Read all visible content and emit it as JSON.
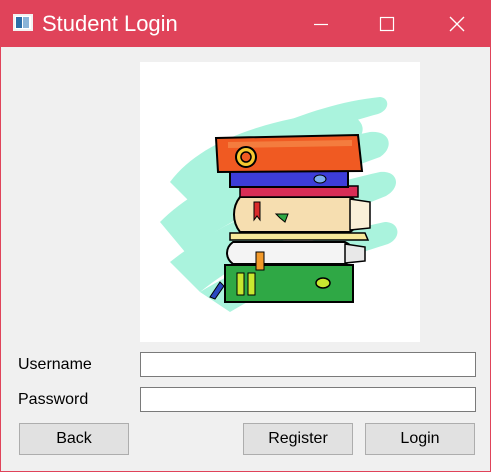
{
  "window": {
    "title": "Student Login",
    "accent_color": "#e0435a",
    "app_icon": "window-app-icon",
    "controls": [
      "minimize-icon",
      "maximize-icon",
      "close-icon"
    ]
  },
  "illustration": {
    "icon": "stack-of-books-icon"
  },
  "form": {
    "username_label": "Username",
    "username_value": "",
    "password_label": "Password",
    "password_value": ""
  },
  "buttons": {
    "back": "Back",
    "register": "Register",
    "login": "Login"
  }
}
